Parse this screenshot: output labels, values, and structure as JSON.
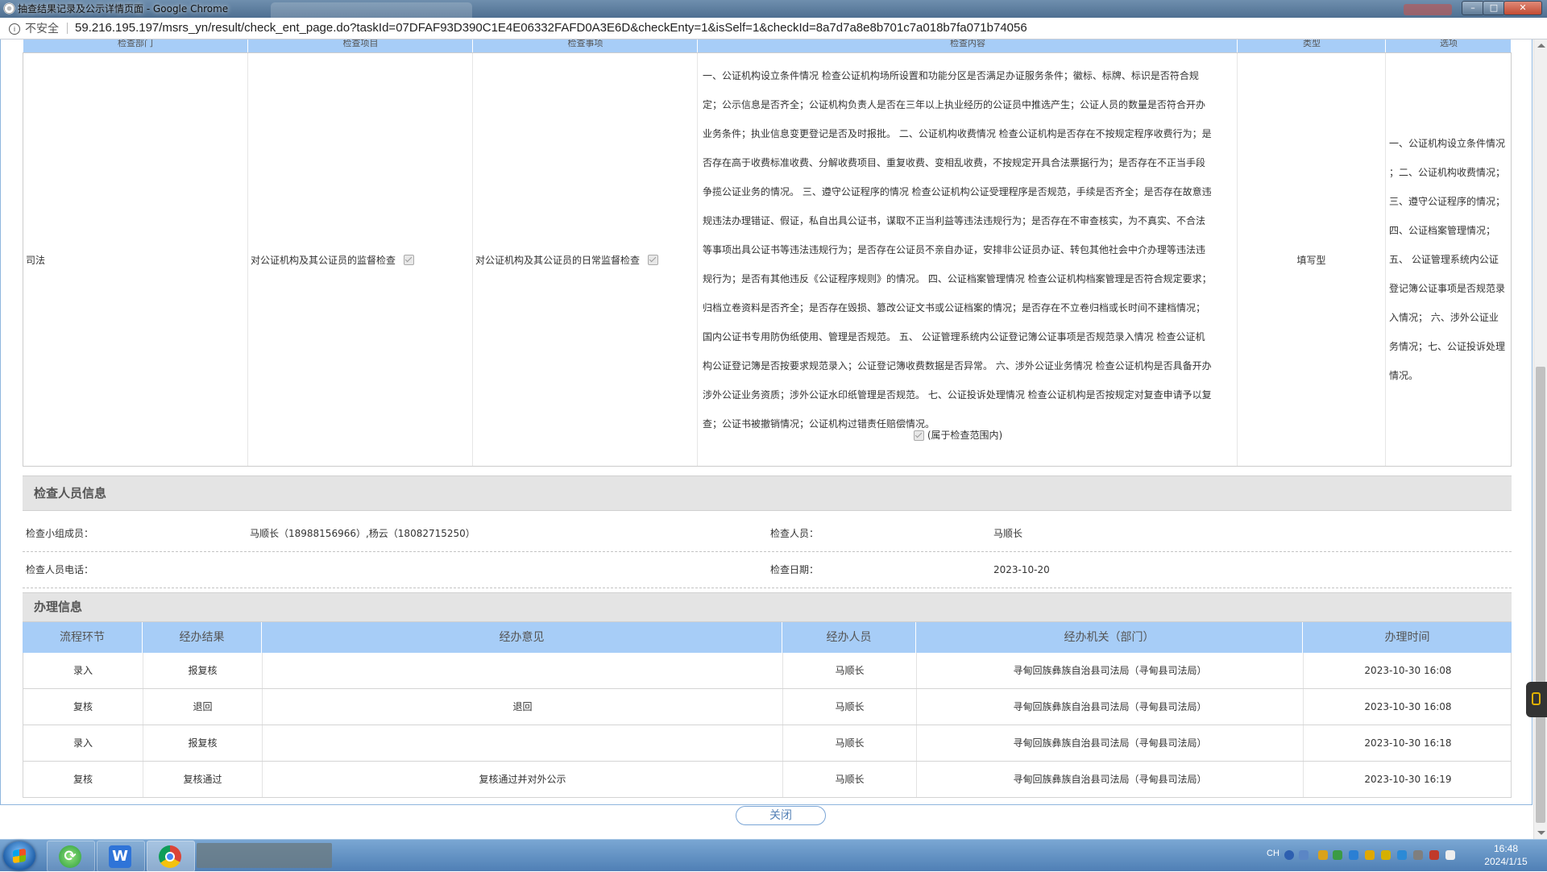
{
  "window": {
    "title": "抽查结果记录及公示详情页面 - Google Chrome"
  },
  "address_bar": {
    "security_label": "不安全",
    "url": "59.216.195.197/msrs_yn/result/check_ent_page.do?taskId=07DFAF93D390C1E4E06332FAFD0A3E6D&checkEnty=1&isSelf=1&checkId=8a7d7a8e8b701c7a018b7fa071b74056"
  },
  "header_band": {
    "columns": [
      "检查部门",
      "检查项目",
      "检查事项",
      "检查内容",
      "类型",
      "选项"
    ]
  },
  "check_table": {
    "department": "司法",
    "item": "对公证机构及其公证员的监督检查",
    "matter": "对公证机构及其公证员的日常监督检查",
    "content": "一、公证机构设立条件情况 检查公证机构场所设置和功能分区是否满足办证服务条件；徽标、标牌、标识是否符合规定；公示信息是否齐全；公证机构负责人是否在三年以上执业经历的公证员中推选产生；公证人员的数量是否符合开办业务条件；执业信息变更登记是否及时报批。 二、公证机构收费情况 检查公证机构是否存在不按规定程序收费行为；是否存在高于收费标准收费、分解收费项目、重复收费、变相乱收费，不按规定开具合法票据行为；是否存在不正当手段争揽公证业务的情况。 三、遵守公证程序的情况 检查公证机构公证受理程序是否规范，手续是否齐全；是否存在故意违规违法办理错证、假证，私自出具公证书，谋取不正当利益等违法违规行为；是否存在不审查核实，为不真实、不合法等事项出具公证书等违法违规行为；是否存在公证员不亲自办证，安排非公证员办证、转包其他社会中介办理等违法违规行为；是否有其他违反《公证程序规则》的情况。 四、公证档案管理情况 检查公证机构档案管理是否符合规定要求；归档立卷资料是否齐全；是否存在毁损、篡改公证文书或公证档案的情况；是否存在不立卷归档或长时间不建档情况；国内公证书专用防伪纸使用、管理是否规范。 五、 公证管理系统内公证登记簿公证事项是否规范录入情况 检查公证机构公证登记簿是否按要求规范录入；公证登记簿收费数据是否异常。 六、涉外公证业务情况 检查公证机构是否具备开办涉外公证业务资质；涉外公证水印纸管理是否规范。 七、公证投诉处理情况 检查公证机构是否按规定对复查申请予以复查；公证书被撤销情况；公证机构过错责任赔偿情况。",
    "scope_label": "(属于检查范围内)",
    "type": "填写型",
    "options": "一、公证机构设立条件情况 ；二、公证机构收费情况；三、遵守公证程序的情况； 四、公证档案管理情况； 五、 公证管理系统内公证登记簿公证事项是否规范录入情况； 六、涉外公证业务情况；七、公证投诉处理情况。"
  },
  "inspector_section": {
    "title": "检查人员信息",
    "team_label": "检查小组成员：",
    "team_value": "马顺长（18988156966）,杨云（18082715250）",
    "inspector_label": "检查人员：",
    "inspector_value": "马顺长",
    "phone_label": "检查人员电话：",
    "phone_value": "",
    "date_label": "检查日期：",
    "date_value": "2023-10-20"
  },
  "process_section": {
    "title": "办理信息",
    "columns": [
      "流程环节",
      "经办结果",
      "经办意见",
      "经办人员",
      "经办机关（部门）",
      "办理时间"
    ],
    "rows": [
      [
        "录入",
        "报复核",
        "",
        "马顺长",
        "寻甸回族彝族自治县司法局（寻甸县司法局）",
        "2023-10-30 16:08"
      ],
      [
        "复核",
        "退回",
        "退回",
        "马顺长",
        "寻甸回族彝族自治县司法局（寻甸县司法局）",
        "2023-10-30 16:08"
      ],
      [
        "录入",
        "报复核",
        "",
        "马顺长",
        "寻甸回族彝族自治县司法局（寻甸县司法局）",
        "2023-10-30 16:18"
      ],
      [
        "复核",
        "复核通过",
        "复核通过并对外公示",
        "马顺长",
        "寻甸回族彝族自治县司法局（寻甸县司法局）",
        "2023-10-30 16:19"
      ]
    ]
  },
  "footer": {
    "close_label": "关闭"
  },
  "taskbar": {
    "wps_glyph": "W",
    "ime": "CH",
    "time": "16:48",
    "date": "2024/1/15"
  }
}
